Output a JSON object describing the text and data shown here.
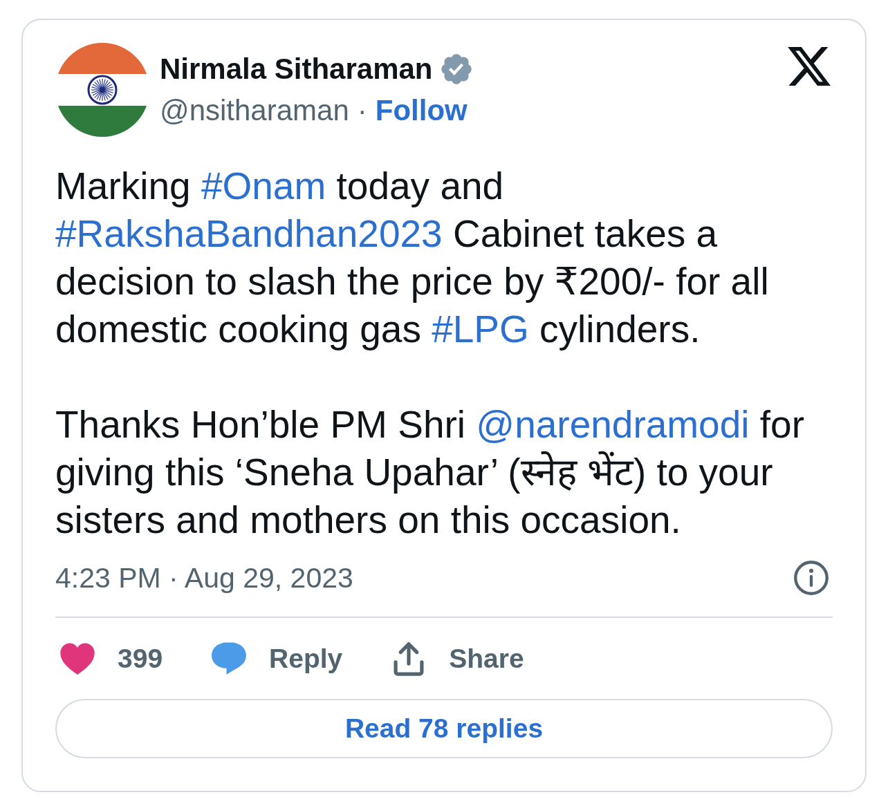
{
  "author": {
    "name": "Nirmala Sitharaman",
    "verified": true,
    "handle": "@nsitharaman",
    "separator": "·",
    "follow_label": "Follow"
  },
  "tweet": {
    "paragraphs": [
      [
        {
          "kind": "text",
          "text": "Marking "
        },
        {
          "kind": "hashtag",
          "text": "#Onam"
        },
        {
          "kind": "text",
          "text": " today and "
        },
        {
          "kind": "hashtag",
          "text": "#RakshaBandhan2023"
        },
        {
          "kind": "text",
          "text": " Cabinet takes a decision to slash the price by ₹200/- for all domestic cooking gas "
        },
        {
          "kind": "hashtag",
          "text": "#LPG"
        },
        {
          "kind": "text",
          "text": " cylinders."
        }
      ],
      [
        {
          "kind": "text",
          "text": "Thanks Hon’ble PM Shri "
        },
        {
          "kind": "mention",
          "text": "@narendramodi"
        },
        {
          "kind": "text",
          "text": " for giving this ‘Sneha Upahar’ (स्नेह भेंट) to your sisters and mothers on this occasion."
        }
      ]
    ]
  },
  "timestamp": "4:23 PM · Aug 29, 2023",
  "actions": [
    {
      "kind": "like",
      "label": "399"
    },
    {
      "kind": "reply",
      "label": "Reply"
    },
    {
      "kind": "share",
      "label": "Share"
    }
  ],
  "read_replies_button": "Read 78 replies"
}
